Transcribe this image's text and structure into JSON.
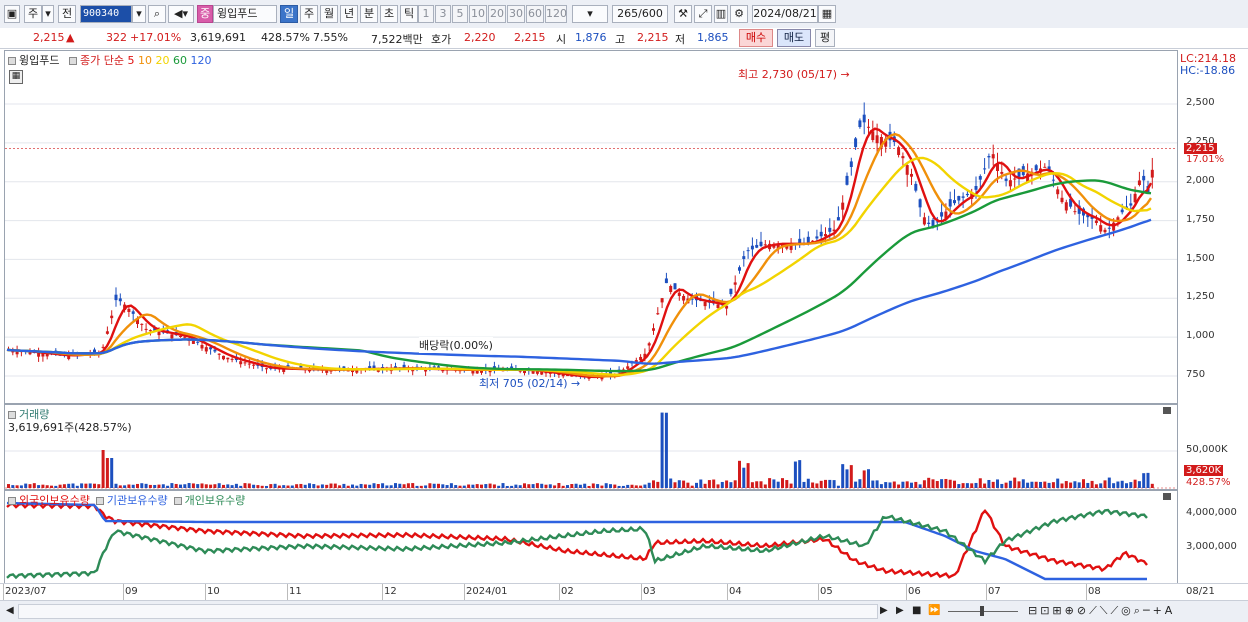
{
  "toolbar": {
    "market_tab": "주",
    "prev_tab": "전",
    "stock_code": "900340",
    "stock_badge": "중",
    "stock_name": "윙입푸드",
    "periods": [
      "일",
      "주",
      "월",
      "년",
      "분",
      "초",
      "틱"
    ],
    "intervals": [
      "1",
      "3",
      "5",
      "10",
      "20",
      "30",
      "60",
      "120"
    ],
    "count": "265",
    "count_max": "/600",
    "date": "2024/08/21",
    "colors": {
      "selected": "#3b74c9"
    }
  },
  "info": {
    "price": "2,215",
    "direction": "▲",
    "change": "322",
    "change_pct": "+17.01%",
    "volume": "3,619,691",
    "volume_pct": "428.57%",
    "turnover_pct": "7.55%",
    "amount": "7,522백만",
    "quote_label": "호가",
    "ask": "2,220",
    "bid": "2,215",
    "open_label": "시",
    "open": "1,876",
    "high_label": "고",
    "high": "2,215",
    "low_label": "저",
    "low": "1,865",
    "buy_label": "매수",
    "sell_label": "매도",
    "eval_label": "평"
  },
  "price_panel": {
    "name": "윙입푸드",
    "legend_prefix": "종가 단순",
    "ma_labels": [
      "5",
      "10",
      "20",
      "60",
      "120"
    ],
    "ma_colors": [
      "#e01010",
      "#f0900a",
      "#f2d400",
      "#1a9a3a",
      "#2e62e0"
    ],
    "lc": "LC:214.18",
    "hc": "HC:-18.86",
    "y_ticks": [
      "2,500",
      "2,250",
      "2,000",
      "1,750",
      "1,500",
      "1,250",
      "1,000",
      "750"
    ],
    "price_tag": "2,215",
    "price_tag_pct": "17.01%",
    "high_note": "최고 2,730 (05/17)",
    "low_note": "최저 705 (02/14)",
    "dividend_note": "배당락(0.00%)"
  },
  "volume_panel": {
    "title": "거래량",
    "value": "3,619,691주(428.57%)",
    "y_tick": "50,000K",
    "tag": "3,620K",
    "tag_pct": "428.57%"
  },
  "holding_panel": {
    "legend": [
      "외국인보유수량",
      "기관보유수량",
      "개인보유수량"
    ],
    "legend_colors": [
      "#e01010",
      "#2e62e0",
      "#2e8b57"
    ],
    "y_ticks": [
      "4,000,000",
      "3,000,000"
    ]
  },
  "x_axis": {
    "labels": [
      "2023/07",
      "09",
      "10",
      "11",
      "12",
      "2024/01",
      "02",
      "03",
      "04",
      "05",
      "06",
      "07",
      "08"
    ],
    "last": "08/21"
  }
}
